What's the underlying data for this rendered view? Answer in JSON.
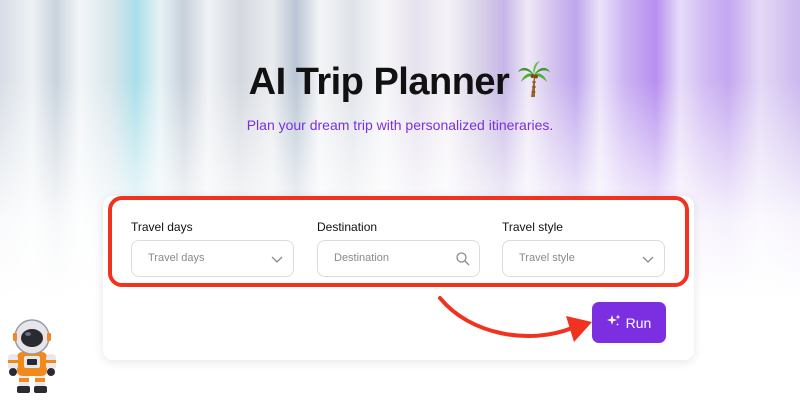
{
  "header": {
    "title": "AI Trip Planner",
    "title_emoji": "palm-tree-icon",
    "subtitle": "Plan your dream trip with personalized itineraries."
  },
  "form": {
    "fields": [
      {
        "label": "Travel days",
        "placeholder": "Travel days",
        "icon": "chevron-down-icon"
      },
      {
        "label": "Destination",
        "placeholder": "Destination",
        "icon": "search-icon"
      },
      {
        "label": "Travel style",
        "placeholder": "Travel style",
        "icon": "chevron-down-icon"
      }
    ],
    "run_label": "Run",
    "run_icon": "sparkle-icon"
  },
  "annotations": {
    "highlight": "red-outline",
    "arrow": "curved-arrow-to-run"
  },
  "colors": {
    "accent": "#7b2fe0",
    "annotation_red": "#f0321f",
    "title": "#111111"
  },
  "mascot": "astronaut-icon"
}
